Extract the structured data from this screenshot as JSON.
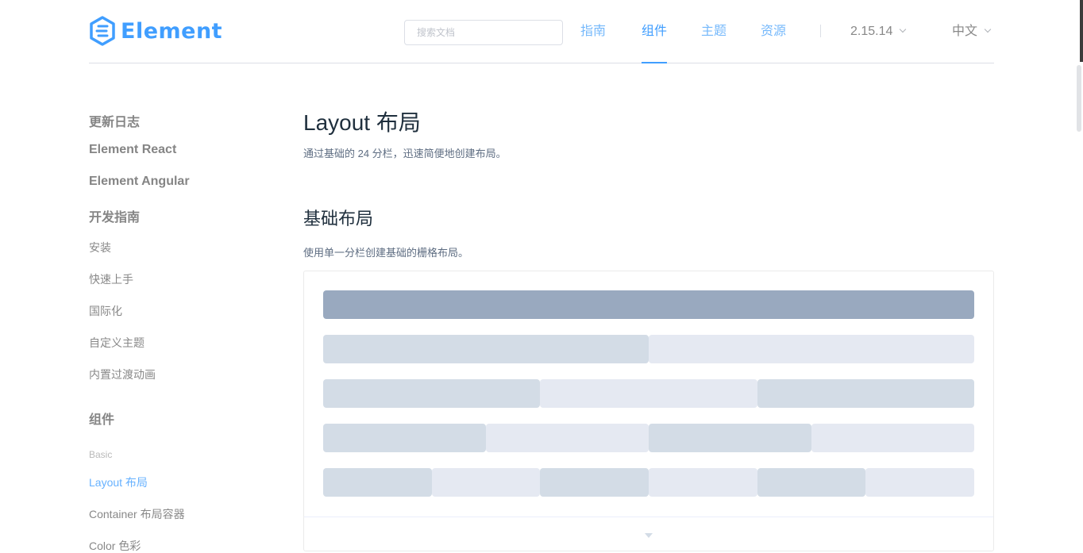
{
  "brand": {
    "logo_text": "Element",
    "color": "#409eff"
  },
  "header": {
    "search": {
      "placeholder": "搜索文档",
      "value": ""
    },
    "nav": [
      {
        "label": "指南",
        "active": false
      },
      {
        "label": "组件",
        "active": true
      },
      {
        "label": "主题",
        "active": false
      },
      {
        "label": "资源",
        "active": false
      }
    ],
    "version": {
      "label": "2.15.14",
      "icon": "chevron-down-icon"
    },
    "language": {
      "label": "中文",
      "icon": "chevron-down-icon"
    }
  },
  "sidebar": {
    "items": [
      {
        "label": "更新日志",
        "kind": "group"
      },
      {
        "label": "Element React",
        "kind": "group"
      },
      {
        "label": "Element Angular",
        "kind": "group"
      },
      {
        "label": "开发指南",
        "kind": "group"
      },
      {
        "label": "安装",
        "kind": "item"
      },
      {
        "label": "快速上手",
        "kind": "item"
      },
      {
        "label": "国际化",
        "kind": "item"
      },
      {
        "label": "自定义主题",
        "kind": "item"
      },
      {
        "label": "内置过渡动画",
        "kind": "item"
      },
      {
        "label": "组件",
        "kind": "group"
      },
      {
        "label": "Basic",
        "kind": "category"
      },
      {
        "label": "Layout 布局",
        "kind": "item",
        "active": true
      },
      {
        "label": "Container 布局容器",
        "kind": "item"
      },
      {
        "label": "Color 色彩",
        "kind": "item"
      }
    ]
  },
  "main": {
    "title": "Layout 布局",
    "subtitle": "通过基础的 24 分栏，迅速简便地创建布局。",
    "section_title": "基础布局",
    "section_desc": "使用单一分栏创建基础的栅格布局。",
    "demo": {
      "grid_total": 24,
      "rows": [
        {
          "span": 24,
          "cols": 1
        },
        {
          "span": 12,
          "cols": 2
        },
        {
          "span": 8,
          "cols": 3
        },
        {
          "span": 6,
          "cols": 4
        },
        {
          "span": 4,
          "cols": 6
        }
      ],
      "colors": {
        "dark": "#99a9bf",
        "mid": "#d3dce6",
        "light": "#e5e9f2"
      },
      "footer_icon": "caret-down-icon"
    }
  }
}
